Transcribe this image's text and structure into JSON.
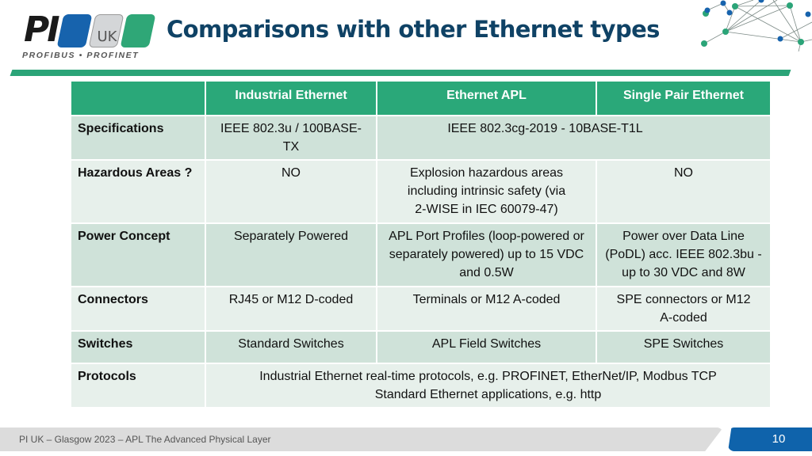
{
  "logo": {
    "mark": "PI",
    "badge": "UK",
    "tagline": "PROFIBUS • PROFINET"
  },
  "title": "Comparisons with other Ethernet types",
  "colors": {
    "title": "#0f4265",
    "accent_green": "#2aa879",
    "accent_blue": "#0f63ab",
    "row_dark": "#cfe2d9",
    "row_light": "#e7f0eb"
  },
  "table": {
    "headers": [
      "",
      "Industrial Ethernet",
      "Ethernet APL",
      "Single Pair Ethernet"
    ],
    "rows": [
      {
        "label": "Specifications",
        "industrial": "IEEE 802.3u / 100BASE-TX",
        "apl_spe_merged": "IEEE 802.3cg-2019  - 10BASE-T1L"
      },
      {
        "label": "Hazardous Areas ?",
        "industrial": "NO",
        "apl": "Explosion hazardous areas including intrinsic safety (via 2-WISE in IEC 60079-47)",
        "spe": "NO"
      },
      {
        "label": "Power Concept",
        "industrial": "Separately Powered",
        "apl": "APL Port Profiles (loop-powered or separately powered) up to 15 VDC and 0.5W",
        "spe": "Power over Data Line (PoDL) acc. IEEE 802.3bu -up to 30 VDC and 8W"
      },
      {
        "label": "Connectors",
        "industrial": "RJ45 or M12 D-coded",
        "apl": "Terminals or M12 A-coded",
        "spe": "SPE connectors or M12 A-coded"
      },
      {
        "label": "Switches",
        "industrial": "Standard Switches",
        "apl": "APL Field Switches",
        "spe": "SPE Switches"
      },
      {
        "label": "Protocols",
        "merged_line1": "Industrial Ethernet real-time protocols, e.g. PROFINET, EtherNet/IP, Modbus TCP",
        "merged_line2": "Standard Ethernet applications, e.g. http"
      }
    ]
  },
  "footer": {
    "text": "PI UK – Glasgow 2023 – APL The Advanced Physical Layer",
    "page_number": "10"
  },
  "icons": {
    "network_graphic": "network-nodes-icon"
  }
}
